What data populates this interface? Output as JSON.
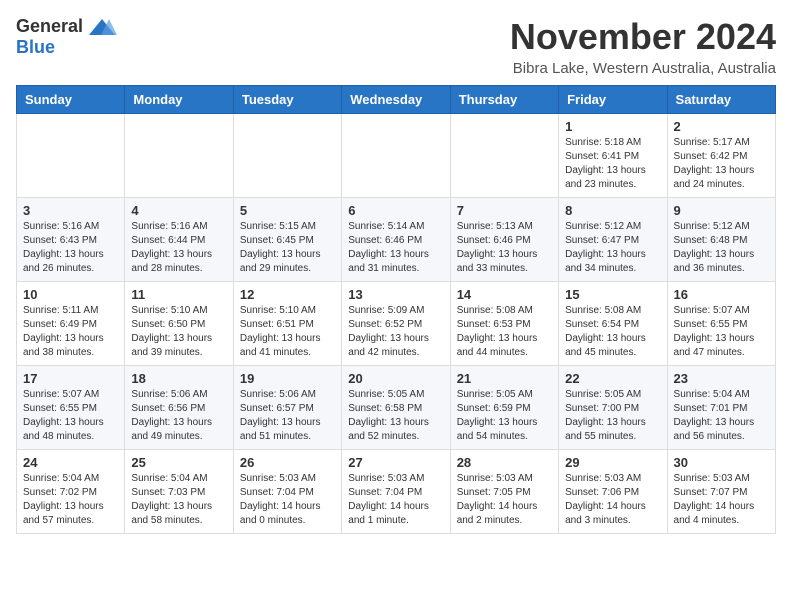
{
  "header": {
    "logo_general": "General",
    "logo_blue": "Blue",
    "month": "November 2024",
    "location": "Bibra Lake, Western Australia, Australia"
  },
  "weekdays": [
    "Sunday",
    "Monday",
    "Tuesday",
    "Wednesday",
    "Thursday",
    "Friday",
    "Saturday"
  ],
  "weeks": [
    [
      {
        "day": "",
        "info": ""
      },
      {
        "day": "",
        "info": ""
      },
      {
        "day": "",
        "info": ""
      },
      {
        "day": "",
        "info": ""
      },
      {
        "day": "",
        "info": ""
      },
      {
        "day": "1",
        "info": "Sunrise: 5:18 AM\nSunset: 6:41 PM\nDaylight: 13 hours\nand 23 minutes."
      },
      {
        "day": "2",
        "info": "Sunrise: 5:17 AM\nSunset: 6:42 PM\nDaylight: 13 hours\nand 24 minutes."
      }
    ],
    [
      {
        "day": "3",
        "info": "Sunrise: 5:16 AM\nSunset: 6:43 PM\nDaylight: 13 hours\nand 26 minutes."
      },
      {
        "day": "4",
        "info": "Sunrise: 5:16 AM\nSunset: 6:44 PM\nDaylight: 13 hours\nand 28 minutes."
      },
      {
        "day": "5",
        "info": "Sunrise: 5:15 AM\nSunset: 6:45 PM\nDaylight: 13 hours\nand 29 minutes."
      },
      {
        "day": "6",
        "info": "Sunrise: 5:14 AM\nSunset: 6:46 PM\nDaylight: 13 hours\nand 31 minutes."
      },
      {
        "day": "7",
        "info": "Sunrise: 5:13 AM\nSunset: 6:46 PM\nDaylight: 13 hours\nand 33 minutes."
      },
      {
        "day": "8",
        "info": "Sunrise: 5:12 AM\nSunset: 6:47 PM\nDaylight: 13 hours\nand 34 minutes."
      },
      {
        "day": "9",
        "info": "Sunrise: 5:12 AM\nSunset: 6:48 PM\nDaylight: 13 hours\nand 36 minutes."
      }
    ],
    [
      {
        "day": "10",
        "info": "Sunrise: 5:11 AM\nSunset: 6:49 PM\nDaylight: 13 hours\nand 38 minutes."
      },
      {
        "day": "11",
        "info": "Sunrise: 5:10 AM\nSunset: 6:50 PM\nDaylight: 13 hours\nand 39 minutes."
      },
      {
        "day": "12",
        "info": "Sunrise: 5:10 AM\nSunset: 6:51 PM\nDaylight: 13 hours\nand 41 minutes."
      },
      {
        "day": "13",
        "info": "Sunrise: 5:09 AM\nSunset: 6:52 PM\nDaylight: 13 hours\nand 42 minutes."
      },
      {
        "day": "14",
        "info": "Sunrise: 5:08 AM\nSunset: 6:53 PM\nDaylight: 13 hours\nand 44 minutes."
      },
      {
        "day": "15",
        "info": "Sunrise: 5:08 AM\nSunset: 6:54 PM\nDaylight: 13 hours\nand 45 minutes."
      },
      {
        "day": "16",
        "info": "Sunrise: 5:07 AM\nSunset: 6:55 PM\nDaylight: 13 hours\nand 47 minutes."
      }
    ],
    [
      {
        "day": "17",
        "info": "Sunrise: 5:07 AM\nSunset: 6:55 PM\nDaylight: 13 hours\nand 48 minutes."
      },
      {
        "day": "18",
        "info": "Sunrise: 5:06 AM\nSunset: 6:56 PM\nDaylight: 13 hours\nand 49 minutes."
      },
      {
        "day": "19",
        "info": "Sunrise: 5:06 AM\nSunset: 6:57 PM\nDaylight: 13 hours\nand 51 minutes."
      },
      {
        "day": "20",
        "info": "Sunrise: 5:05 AM\nSunset: 6:58 PM\nDaylight: 13 hours\nand 52 minutes."
      },
      {
        "day": "21",
        "info": "Sunrise: 5:05 AM\nSunset: 6:59 PM\nDaylight: 13 hours\nand 54 minutes."
      },
      {
        "day": "22",
        "info": "Sunrise: 5:05 AM\nSunset: 7:00 PM\nDaylight: 13 hours\nand 55 minutes."
      },
      {
        "day": "23",
        "info": "Sunrise: 5:04 AM\nSunset: 7:01 PM\nDaylight: 13 hours\nand 56 minutes."
      }
    ],
    [
      {
        "day": "24",
        "info": "Sunrise: 5:04 AM\nSunset: 7:02 PM\nDaylight: 13 hours\nand 57 minutes."
      },
      {
        "day": "25",
        "info": "Sunrise: 5:04 AM\nSunset: 7:03 PM\nDaylight: 13 hours\nand 58 minutes."
      },
      {
        "day": "26",
        "info": "Sunrise: 5:03 AM\nSunset: 7:04 PM\nDaylight: 14 hours\nand 0 minutes."
      },
      {
        "day": "27",
        "info": "Sunrise: 5:03 AM\nSunset: 7:04 PM\nDaylight: 14 hours\nand 1 minute."
      },
      {
        "day": "28",
        "info": "Sunrise: 5:03 AM\nSunset: 7:05 PM\nDaylight: 14 hours\nand 2 minutes."
      },
      {
        "day": "29",
        "info": "Sunrise: 5:03 AM\nSunset: 7:06 PM\nDaylight: 14 hours\nand 3 minutes."
      },
      {
        "day": "30",
        "info": "Sunrise: 5:03 AM\nSunset: 7:07 PM\nDaylight: 14 hours\nand 4 minutes."
      }
    ]
  ]
}
